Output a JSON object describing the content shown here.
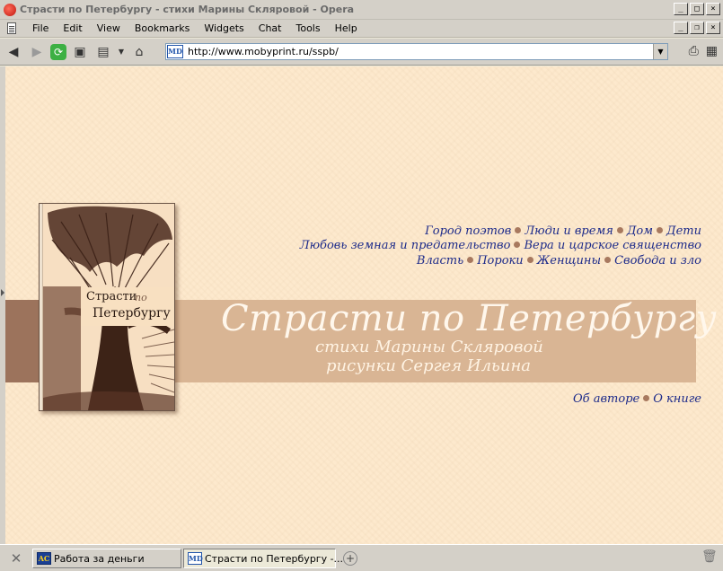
{
  "window": {
    "title": "Страсти по Петербургу - стихи Марины Скляровой - Opera"
  },
  "menu": {
    "items": [
      "File",
      "Edit",
      "View",
      "Bookmarks",
      "Widgets",
      "Chat",
      "Tools",
      "Help"
    ]
  },
  "address": {
    "favicon_text": "MD",
    "url": "http://www.mobyprint.ru/sspb/"
  },
  "page": {
    "nav_line1": [
      "Город поэтов",
      "Люди и время",
      "Дом",
      "Дети"
    ],
    "nav_line2": [
      "Любовь земная и предательство",
      "Вера и царское священство"
    ],
    "nav_line3": [
      "Власть",
      "Пороки",
      "Женщины",
      "Свобода и зло"
    ],
    "title": "Страсти по Петербургу",
    "subtitle_author": "стихи Марины Скляровой",
    "subtitle_artist": "рисунки Сергея Ильина",
    "bottom_links": [
      "Об авторе",
      "О книге"
    ],
    "book": {
      "line1": "Страсти",
      "line2": "по",
      "line3": "Петербургу"
    }
  },
  "taskbar": {
    "tasks": [
      {
        "icon_text": "AC",
        "label": "Работа за деньги"
      },
      {
        "icon_text": "MD",
        "label": "Страсти по Петербургу -..."
      }
    ]
  },
  "colors": {
    "page_bg": "#fde9cd",
    "link": "#1d2b8a",
    "band": "#d9b594",
    "band_dark": "#9c735c",
    "bullet": "#a8795f"
  },
  "icons": [
    "opera-icon",
    "back-icon",
    "forward-icon",
    "reload-icon",
    "camera-icon",
    "clipboard-icon",
    "home-icon",
    "print-icon",
    "tools-icon",
    "new-tab-icon",
    "trash-icon"
  ]
}
